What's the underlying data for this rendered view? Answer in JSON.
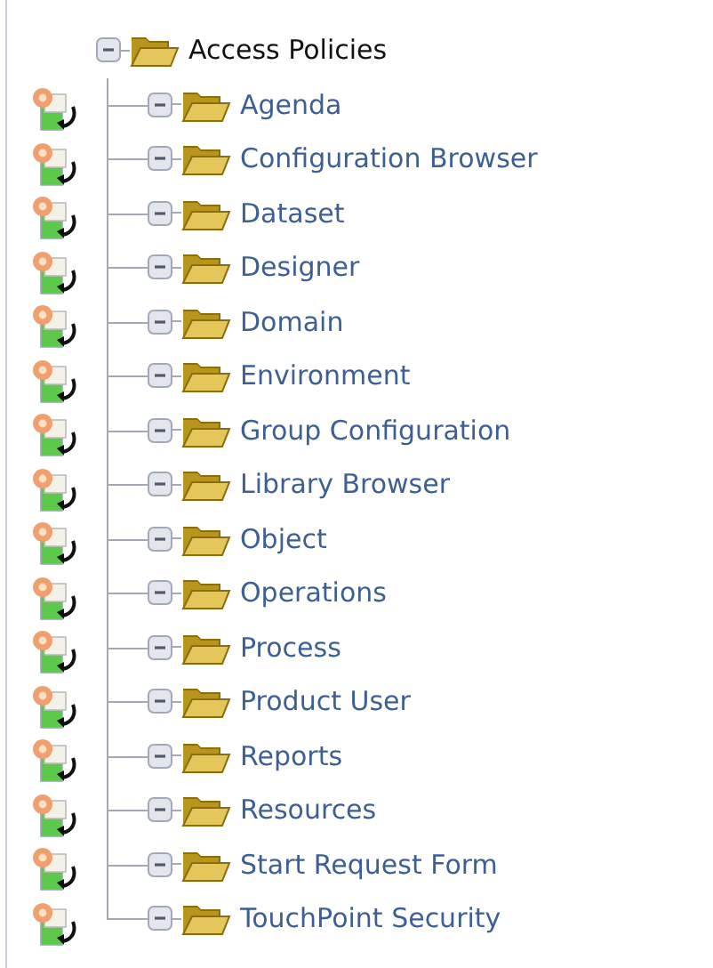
{
  "tree": {
    "label": "Access Policies",
    "expanded": true,
    "children": [
      {
        "label": "Agenda",
        "expanded": true
      },
      {
        "label": "Configuration Browser",
        "expanded": true
      },
      {
        "label": "Dataset",
        "expanded": true
      },
      {
        "label": "Designer",
        "expanded": true
      },
      {
        "label": "Domain",
        "expanded": true
      },
      {
        "label": "Environment",
        "expanded": true
      },
      {
        "label": "Group Configuration",
        "expanded": true
      },
      {
        "label": "Library Browser",
        "expanded": true
      },
      {
        "label": "Object",
        "expanded": true
      },
      {
        "label": "Operations",
        "expanded": true
      },
      {
        "label": "Process",
        "expanded": true
      },
      {
        "label": "Product User",
        "expanded": true
      },
      {
        "label": "Reports",
        "expanded": true
      },
      {
        "label": "Resources",
        "expanded": true
      },
      {
        "label": "Start Request Form",
        "expanded": true
      },
      {
        "label": "TouchPoint Security",
        "expanded": true
      }
    ]
  }
}
